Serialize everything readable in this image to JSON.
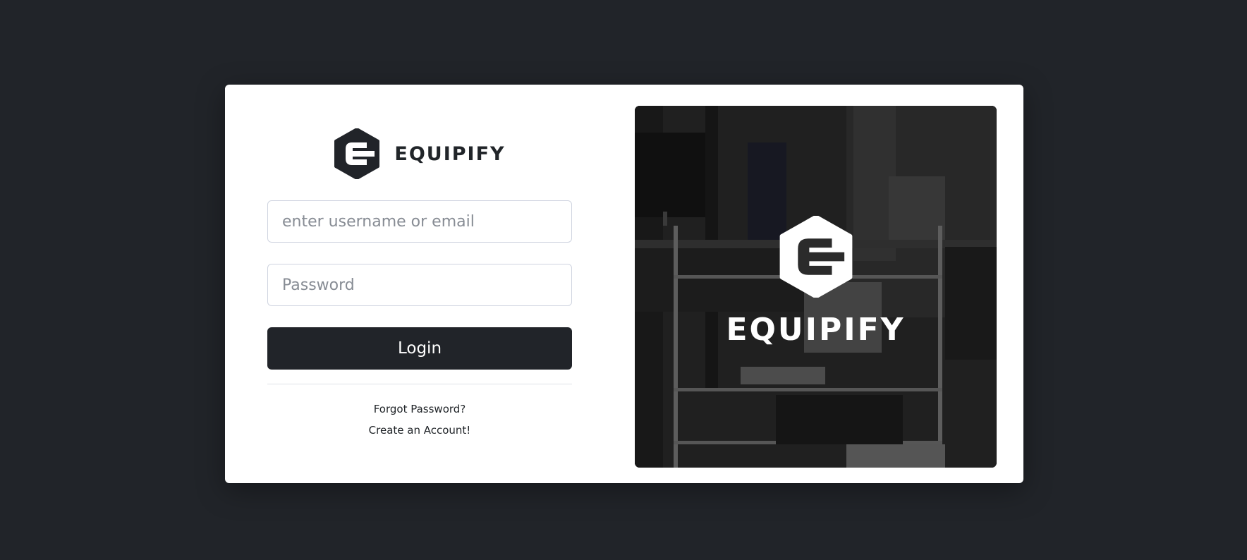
{
  "brand": {
    "name": "EQUIPIFY",
    "logo_icon": "equipify-hexagon-e-logo"
  },
  "login_form": {
    "username_placeholder": "enter username or email",
    "password_placeholder": "Password",
    "login_label": "Login",
    "forgot_password_label": "Forgot Password?",
    "create_account_label": "Create an Account!"
  },
  "hero": {
    "brand_name": "EQUIPIFY",
    "image": "dark office photo with monitors and wire shelving"
  },
  "colors": {
    "background": "#212429",
    "card": "#ffffff",
    "button": "#212429",
    "text": "#212529"
  }
}
